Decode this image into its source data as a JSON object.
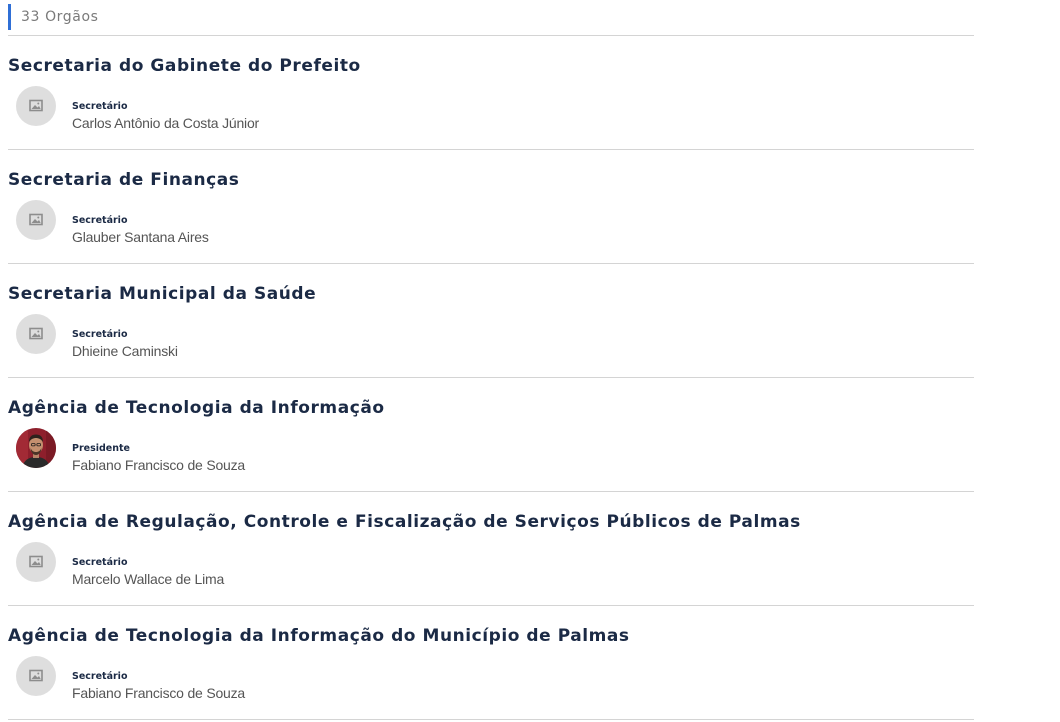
{
  "header": {
    "count_label": "33 Orgãos"
  },
  "orgs": [
    {
      "name": "Secretaria do Gabinete do Prefeito",
      "role": "Secretário",
      "person": "Carlos Antônio da Costa Júnior",
      "photo": "placeholder-image-icon"
    },
    {
      "name": "Secretaria de Finanças",
      "role": "Secretário",
      "person": "Glauber Santana Aires",
      "photo": "placeholder-image-icon"
    },
    {
      "name": "Secretaria Municipal da Saúde",
      "role": "Secretário",
      "person": "Dhieine Caminski",
      "photo": "placeholder-image-icon"
    },
    {
      "name": "Agência de Tecnologia da Informação",
      "role": "Presidente",
      "person": "Fabiano Francisco de Souza",
      "photo": "person-photo"
    },
    {
      "name": "Agência de Regulação, Controle e Fiscalização de Serviços Públicos de Palmas",
      "role": "Secretário",
      "person": "Marcelo Wallace de Lima",
      "photo": "placeholder-image-icon"
    },
    {
      "name": "Agência de Tecnologia da Informação do Município de Palmas",
      "role": "Secretário",
      "person": "Fabiano Francisco de Souza",
      "photo": "placeholder-image-icon"
    }
  ],
  "colors": {
    "accent_bar": "#2f6fd6",
    "title_text": "#1b2a45",
    "name_text": "#555555",
    "divider": "#d4d4d4",
    "avatar_placeholder": "#dedede"
  }
}
